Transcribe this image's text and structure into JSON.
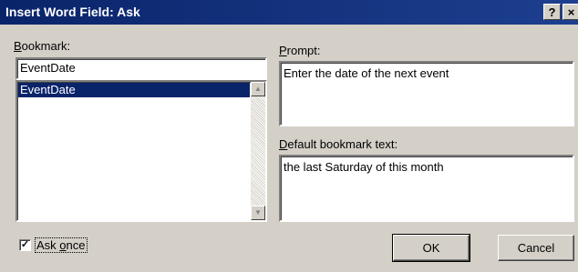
{
  "window": {
    "title": "Insert Word Field: Ask",
    "help_label": "?",
    "close_label": "×"
  },
  "bookmark": {
    "label_prefix": "",
    "label_hotkey": "B",
    "label_rest": "ookmark:",
    "value": "EventDate",
    "list_items": [
      "EventDate"
    ]
  },
  "prompt": {
    "label_hotkey": "P",
    "label_rest": "rompt:",
    "value": "Enter the date of the next event"
  },
  "default_text": {
    "label_hotkey": "D",
    "label_rest": "efault bookmark text:",
    "value": "the last Saturday of this month"
  },
  "ask_once": {
    "checked": true,
    "check_glyph": "✓",
    "label_prefix": "Ask ",
    "label_hotkey": "o",
    "label_rest": "nce"
  },
  "buttons": {
    "ok": "OK",
    "cancel": "Cancel"
  }
}
